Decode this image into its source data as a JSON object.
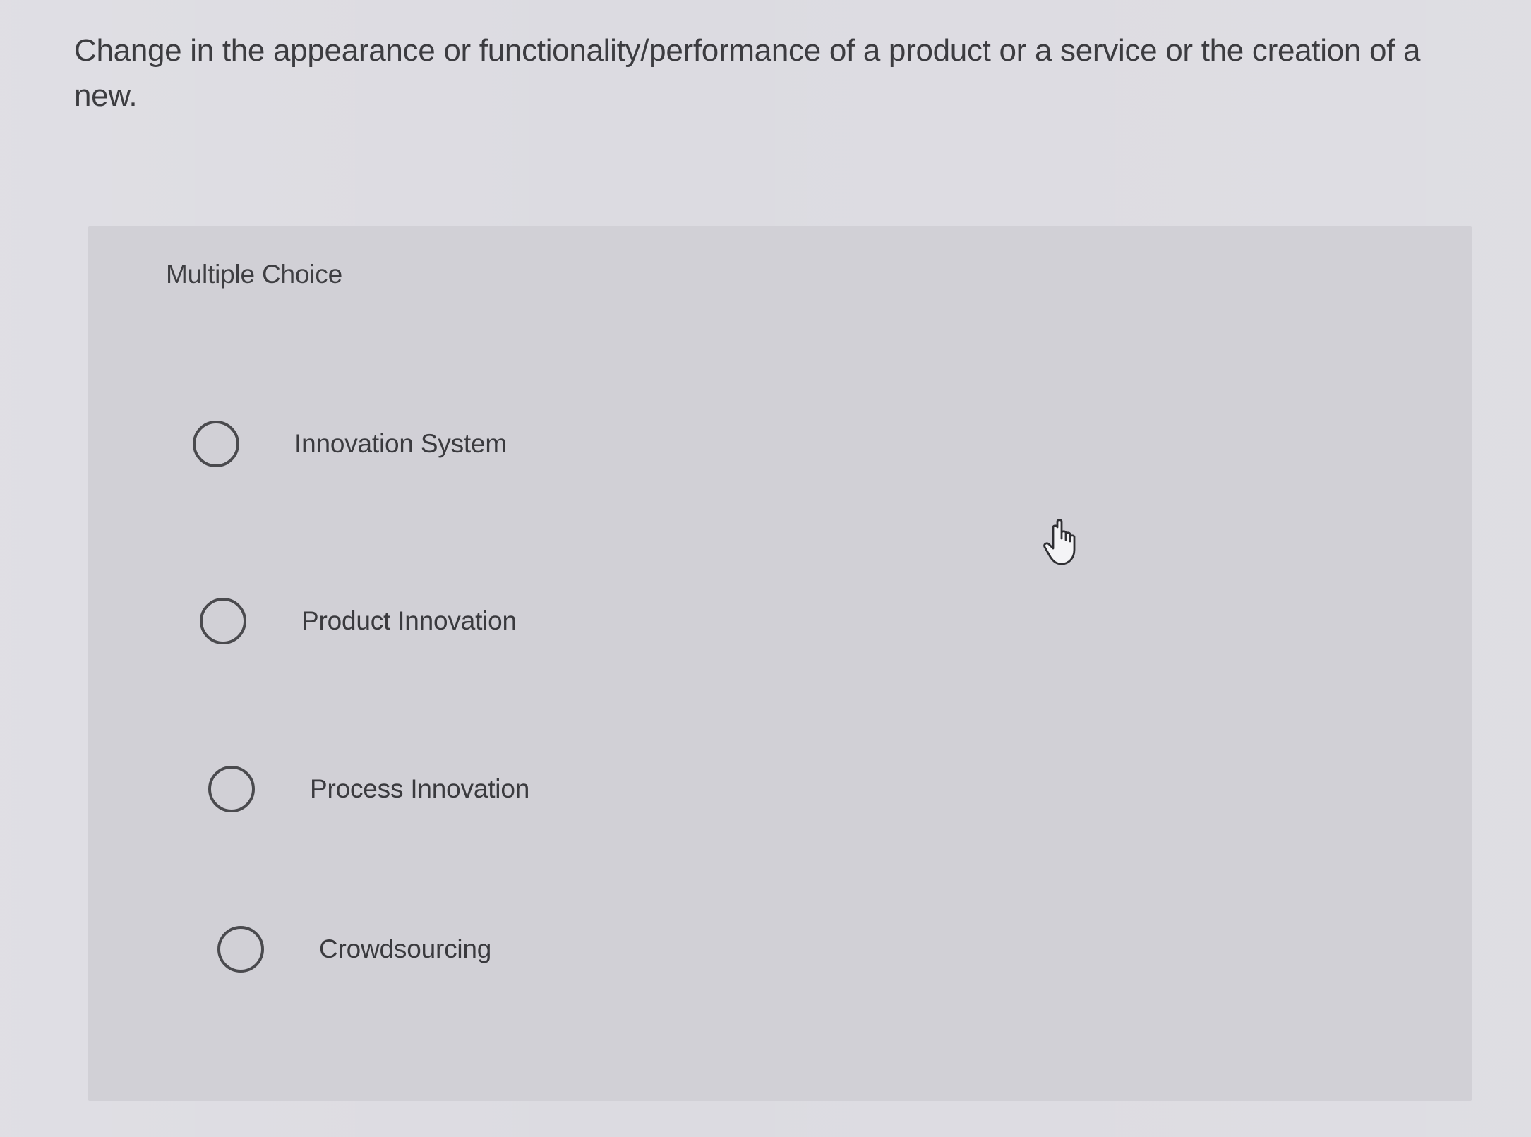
{
  "question": {
    "text": "Change in the appearance or functionality/performance of a product or a service or the creation of a new."
  },
  "panel": {
    "label": "Multiple Choice"
  },
  "options": [
    {
      "label": "Innovation System",
      "selected": false
    },
    {
      "label": "Product Innovation",
      "selected": false
    },
    {
      "label": "Process Innovation",
      "selected": false
    },
    {
      "label": "Crowdsourcing",
      "selected": false
    }
  ],
  "cursor": {
    "icon": "hand-pointer-icon"
  }
}
